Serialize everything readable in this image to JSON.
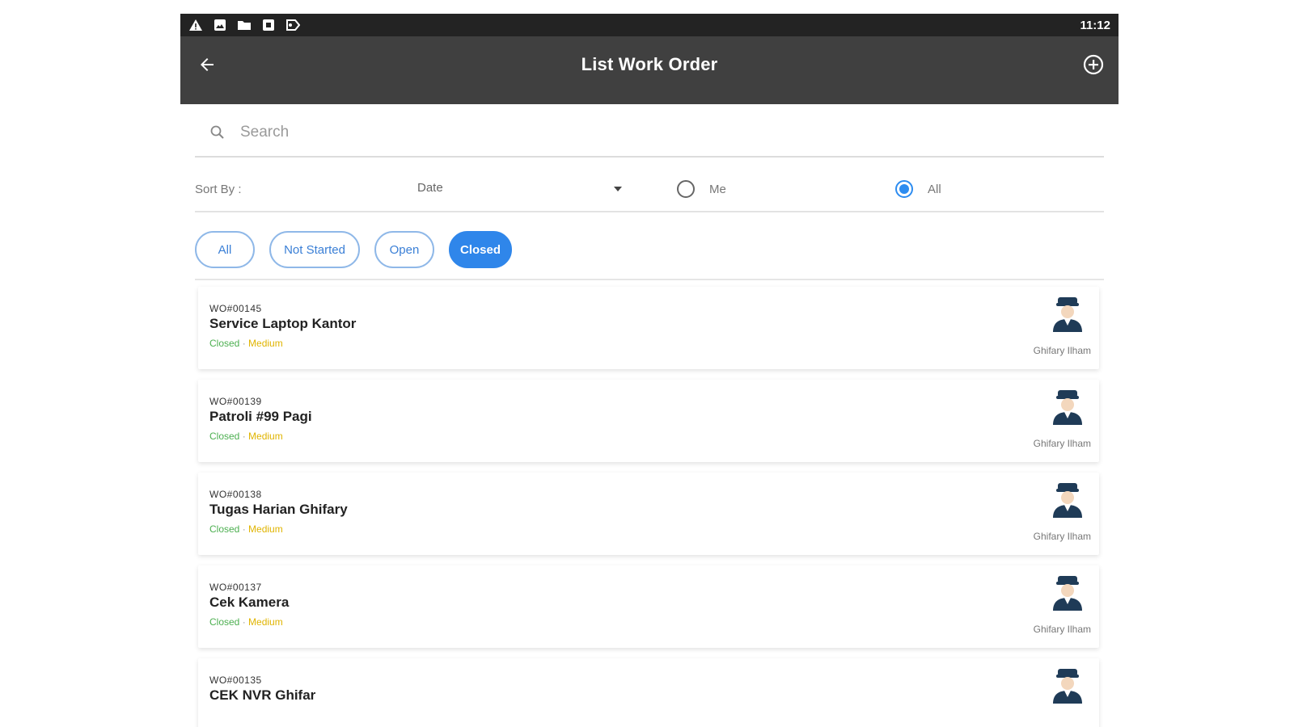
{
  "status_bar": {
    "time": "11:12",
    "icons": [
      "warning-icon",
      "image-icon",
      "folder-icon",
      "app-icon",
      "cast-icon"
    ]
  },
  "app_bar": {
    "title": "List Work Order",
    "back_icon": "arrow-left-icon",
    "add_icon": "plus-circle-icon"
  },
  "search": {
    "placeholder": "Search",
    "value": ""
  },
  "sort": {
    "label": "Sort By :",
    "selected": "Date",
    "radio_me": "Me",
    "radio_all": "All",
    "selected_radio": "All"
  },
  "filters": [
    {
      "label": "All",
      "active": false
    },
    {
      "label": "Not Started",
      "active": false
    },
    {
      "label": "Open",
      "active": false
    },
    {
      "label": "Closed",
      "active": true
    }
  ],
  "colors": {
    "accent": "#2f86ea",
    "status_closed": "#4caf50",
    "priority_medium": "#e0b400",
    "app_bar": "#404040"
  },
  "work_orders": [
    {
      "id": "WO#00145",
      "title": "Service Laptop Kantor",
      "status": "Closed",
      "priority": "Medium",
      "assignee": "Ghifary Ilham"
    },
    {
      "id": "WO#00139",
      "title": "Patroli #99 Pagi",
      "status": "Closed",
      "priority": "Medium",
      "assignee": "Ghifary Ilham"
    },
    {
      "id": "WO#00138",
      "title": "Tugas Harian Ghifary",
      "status": "Closed",
      "priority": "Medium",
      "assignee": "Ghifary Ilham"
    },
    {
      "id": "WO#00137",
      "title": "Cek Kamera",
      "status": "Closed",
      "priority": "Medium",
      "assignee": "Ghifary Ilham"
    },
    {
      "id": "WO#00135",
      "title": "CEK NVR Ghifar",
      "status": "",
      "priority": "",
      "assignee": ""
    }
  ]
}
